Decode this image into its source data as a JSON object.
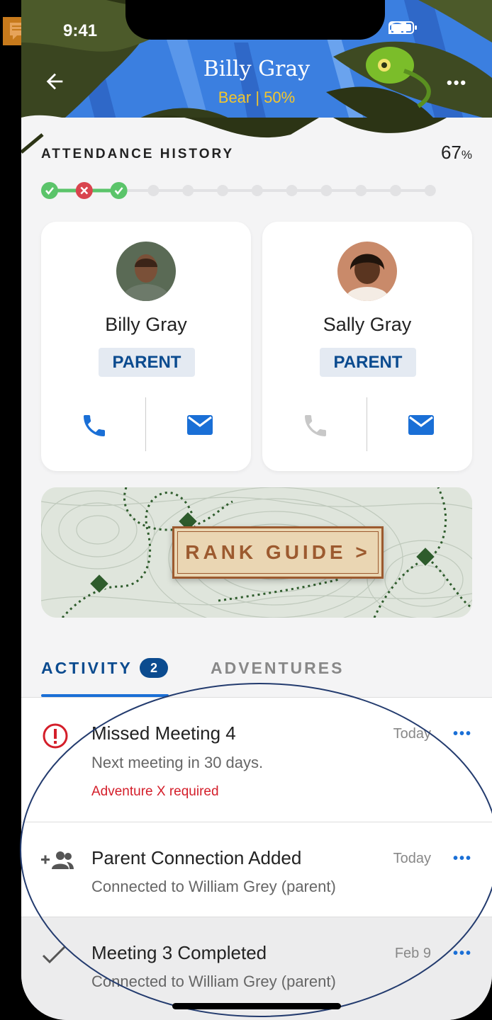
{
  "status_bar": {
    "time": "9:41"
  },
  "header": {
    "title": "Billy Gray",
    "subtitle": "Bear | 50%"
  },
  "attendance": {
    "label": "ATTENDANCE HISTORY",
    "percent": "67",
    "percent_unit": "%",
    "sessions": [
      "attended",
      "missed",
      "attended",
      "none",
      "none",
      "none",
      "none",
      "none",
      "none",
      "none",
      "none",
      "none"
    ]
  },
  "contacts": [
    {
      "name": "Billy Gray",
      "role": "PARENT"
    },
    {
      "name": "Sally Gray",
      "role": "PARENT"
    }
  ],
  "rank_guide": {
    "label": "RANK GUIDE >"
  },
  "tabs": {
    "activity": "ACTIVITY",
    "activity_count": "2",
    "adventures": "ADVENTURES"
  },
  "activity": [
    {
      "title": "Missed Meeting 4",
      "sub": "Next meeting in 30 days.",
      "warn": "Adventure X required",
      "date": "Today",
      "more": "•••"
    },
    {
      "title": "Parent Connection Added",
      "sub": "Connected to William Grey (parent)",
      "date": "Today",
      "more": "•••"
    },
    {
      "title": "Meeting 3 Completed",
      "sub": "Connected to William Grey (parent)",
      "date": "Feb 9",
      "more": "•••"
    }
  ],
  "colors": {
    "primary": "#0b4b8f",
    "accent": "#1a6fd6",
    "green": "#5bc46a",
    "red": "#d9444e",
    "gold": "#f3c62c"
  }
}
